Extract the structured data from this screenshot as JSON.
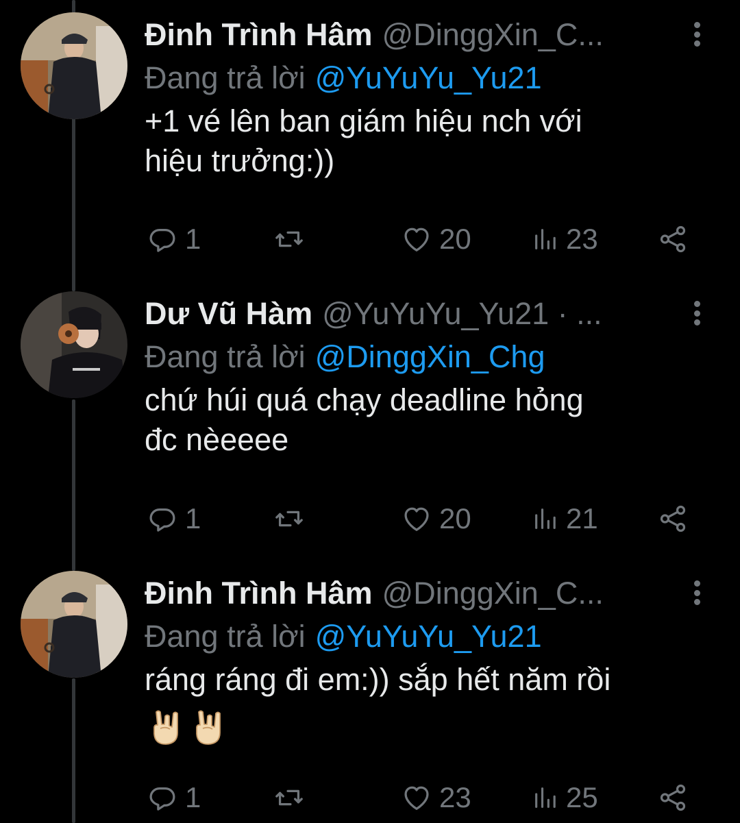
{
  "thread": {
    "tweets": [
      {
        "display_name": "Đinh Trình Hâm",
        "handle": "@DinggXin_C...",
        "reply_prefix": "Đang trả lời",
        "reply_target": "@YuYuYu_Yu21",
        "text": "+1 vé lên ban giám hiệu nch với\nhiệu trưởng:))",
        "emojis": [],
        "metrics": {
          "replies": "1",
          "retweets": "",
          "likes": "20",
          "views": "23"
        }
      },
      {
        "display_name": "Dư Vũ Hàm",
        "handle": "@YuYuYu_Yu21 · ...",
        "reply_prefix": "Đang trả lời",
        "reply_target": "@DinggXin_Chg",
        "text": "chứ húi quá chạy deadline hỏng\nđc nèeeee",
        "emojis": [],
        "metrics": {
          "replies": "1",
          "retweets": "",
          "likes": "20",
          "views": "21"
        }
      },
      {
        "display_name": "Đinh Trình Hâm",
        "handle": "@DinggXin_C...",
        "reply_prefix": "Đang trả lời",
        "reply_target": "@YuYuYu_Yu21",
        "text": "ráng ráng đi em:)) sắp hết năm rồi",
        "emojis": [
          "horns-hand-emoji",
          "horns-hand-emoji"
        ],
        "metrics": {
          "replies": "1",
          "retweets": "",
          "likes": "23",
          "views": "25"
        }
      }
    ]
  },
  "colors": {
    "background": "#000000",
    "primary_text": "#e7e9ea",
    "secondary_text": "#71767b",
    "accent": "#1d9bf0",
    "thread_line": "#333639"
  },
  "icons": {
    "reply": "reply-icon",
    "retweet": "retweet-icon",
    "like": "heart-icon",
    "views": "views-icon",
    "share": "share-icon",
    "more": "more-vertical-icon"
  }
}
